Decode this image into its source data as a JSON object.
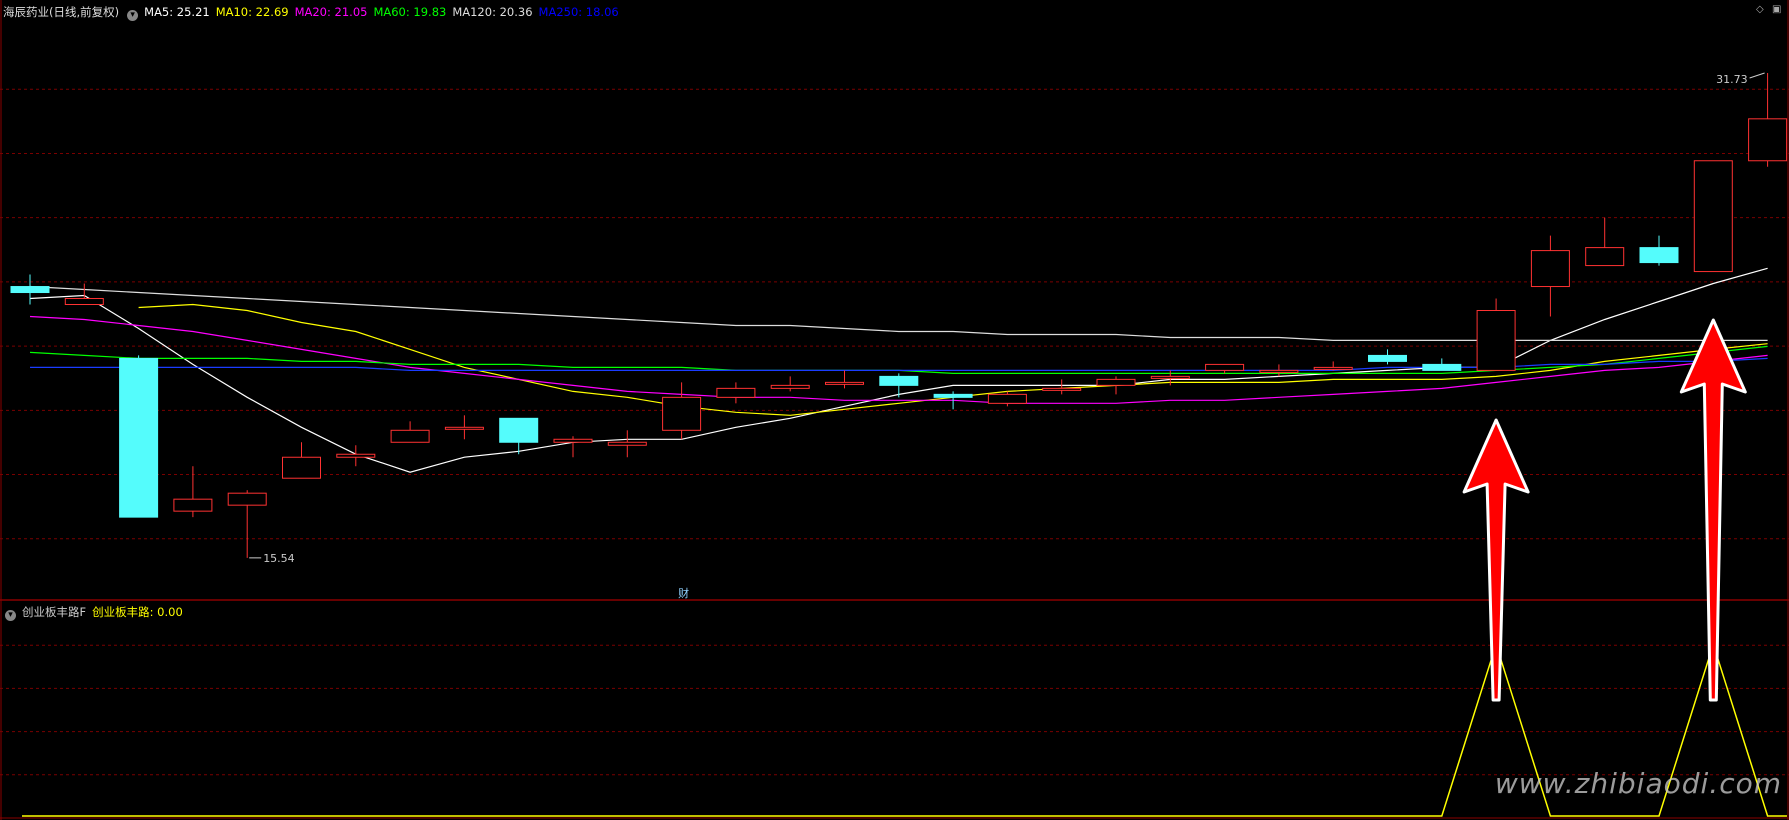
{
  "header": {
    "stock": "海辰药业(日线,前复权)",
    "ma": [
      {
        "label": "MA5: 25.21",
        "color": "#ffffff"
      },
      {
        "label": "MA10: 22.69",
        "color": "#ffff00"
      },
      {
        "label": "MA20: 21.05",
        "color": "#ff00ff"
      },
      {
        "label": "MA60: 19.83",
        "color": "#00ff00"
      },
      {
        "label": "MA120: 20.36",
        "color": "#dddddd"
      },
      {
        "label": "MA250: 18.06",
        "color": "#0000ff"
      }
    ]
  },
  "sub_header": {
    "indicator": "创业板丰路F",
    "value_label": "创业板丰路: 0.00",
    "value_color": "#ffff00"
  },
  "annotations": {
    "high_label": "31.73",
    "low_label": "15.54",
    "event_marker": "财",
    "watermark": "www.zhibiaodi.com"
  },
  "colors": {
    "up": "#ff3232",
    "down": "#54fcfc",
    "grid": "#7a0000",
    "indicator": "#ffff00",
    "arrow": "#ff0000"
  },
  "chart_data": {
    "type": "candlestick",
    "ylim": [
      14.2,
      33.5
    ],
    "candles": [
      {
        "o": 24.6,
        "h": 25.0,
        "l": 24.0,
        "c": 24.4
      },
      {
        "o": 24.0,
        "h": 24.7,
        "l": 24.0,
        "c": 24.2
      },
      {
        "o": 22.2,
        "h": 22.3,
        "l": 16.9,
        "c": 16.9
      },
      {
        "o": 17.1,
        "h": 18.6,
        "l": 16.9,
        "c": 17.5
      },
      {
        "o": 17.3,
        "h": 17.8,
        "l": 15.54,
        "c": 17.7
      },
      {
        "o": 18.2,
        "h": 19.4,
        "l": 18.2,
        "c": 18.9
      },
      {
        "o": 18.9,
        "h": 19.3,
        "l": 18.6,
        "c": 19.0
      },
      {
        "o": 19.4,
        "h": 20.1,
        "l": 19.4,
        "c": 19.8
      },
      {
        "o": 19.9,
        "h": 20.3,
        "l": 19.5,
        "c": 19.9
      },
      {
        "o": 20.2,
        "h": 20.2,
        "l": 19.0,
        "c": 19.4
      },
      {
        "o": 19.4,
        "h": 19.6,
        "l": 18.9,
        "c": 19.5
      },
      {
        "o": 19.3,
        "h": 19.8,
        "l": 18.9,
        "c": 19.4
      },
      {
        "o": 19.8,
        "h": 21.4,
        "l": 19.5,
        "c": 20.9
      },
      {
        "o": 20.9,
        "h": 21.4,
        "l": 20.7,
        "c": 21.2
      },
      {
        "o": 21.2,
        "h": 21.6,
        "l": 21.1,
        "c": 21.3
      },
      {
        "o": 21.4,
        "h": 21.8,
        "l": 21.2,
        "c": 21.4
      },
      {
        "o": 21.6,
        "h": 21.7,
        "l": 20.9,
        "c": 21.3
      },
      {
        "o": 21.0,
        "h": 21.1,
        "l": 20.5,
        "c": 20.9
      },
      {
        "o": 20.7,
        "h": 21.1,
        "l": 20.6,
        "c": 21.0
      },
      {
        "o": 21.2,
        "h": 21.5,
        "l": 21.0,
        "c": 21.2
      },
      {
        "o": 21.3,
        "h": 21.6,
        "l": 21.0,
        "c": 21.5
      },
      {
        "o": 21.6,
        "h": 21.8,
        "l": 21.3,
        "c": 21.6
      },
      {
        "o": 21.8,
        "h": 22.0,
        "l": 21.7,
        "c": 22.0
      },
      {
        "o": 21.8,
        "h": 22.0,
        "l": 21.6,
        "c": 21.8
      },
      {
        "o": 21.9,
        "h": 22.1,
        "l": 21.8,
        "c": 21.9
      },
      {
        "o": 22.3,
        "h": 22.5,
        "l": 22.0,
        "c": 22.1
      },
      {
        "o": 22.0,
        "h": 22.2,
        "l": 21.8,
        "c": 21.8
      },
      {
        "o": 21.8,
        "h": 24.2,
        "l": 21.8,
        "c": 23.8
      },
      {
        "o": 24.6,
        "h": 26.3,
        "l": 23.6,
        "c": 25.8
      },
      {
        "o": 25.3,
        "h": 26.9,
        "l": 25.3,
        "c": 25.9
      },
      {
        "o": 25.9,
        "h": 26.3,
        "l": 25.3,
        "c": 25.4
      },
      {
        "o": 25.1,
        "h": 28.8,
        "l": 25.1,
        "c": 28.8
      },
      {
        "o": 28.8,
        "h": 31.73,
        "l": 28.6,
        "c": 30.2
      }
    ],
    "ma_series": [
      {
        "name": "MA5",
        "color": "#ffffff",
        "values": [
          24.2,
          24.3,
          23.2,
          22.0,
          20.9,
          19.9,
          19.0,
          18.4,
          18.9,
          19.1,
          19.4,
          19.5,
          19.5,
          19.9,
          20.2,
          20.6,
          21.0,
          21.3,
          21.3,
          21.3,
          21.3,
          21.5,
          21.5,
          21.6,
          21.7,
          21.8,
          21.9,
          21.9,
          22.8,
          23.5,
          24.1,
          24.7,
          25.21
        ]
      },
      {
        "name": "MA10",
        "color": "#ffff00",
        "values": [
          23.9,
          24.0,
          23.8,
          23.4,
          23.1,
          22.5,
          21.9,
          21.5,
          21.1,
          20.9,
          20.6,
          20.4,
          20.3,
          20.5,
          20.7,
          20.9,
          21.1,
          21.2,
          21.3,
          21.4,
          21.4,
          21.4,
          21.5,
          21.5,
          21.5,
          21.6,
          21.8,
          22.1,
          22.3,
          22.5,
          22.69
        ]
      },
      {
        "name": "MA20",
        "color": "#ff00ff",
        "values": [
          23.6,
          23.5,
          23.3,
          23.1,
          22.8,
          22.5,
          22.2,
          21.9,
          21.7,
          21.5,
          21.3,
          21.1,
          21.0,
          20.9,
          20.9,
          20.8,
          20.8,
          20.8,
          20.7,
          20.7,
          20.7,
          20.8,
          20.8,
          20.9,
          21.0,
          21.1,
          21.2,
          21.4,
          21.6,
          21.8,
          21.9,
          22.1,
          22.3
        ]
      },
      {
        "name": "MA60",
        "color": "#00ff00",
        "values": [
          22.4,
          22.3,
          22.2,
          22.2,
          22.2,
          22.1,
          22.1,
          22.0,
          22.0,
          22.0,
          21.9,
          21.9,
          21.9,
          21.8,
          21.8,
          21.8,
          21.8,
          21.7,
          21.7,
          21.7,
          21.7,
          21.7,
          21.7,
          21.7,
          21.7,
          21.7,
          21.7,
          21.8,
          21.9,
          22.0,
          22.2,
          22.4,
          22.6
        ]
      },
      {
        "name": "MA120",
        "color": "#dddddd",
        "values": [
          24.6,
          24.5,
          24.4,
          24.3,
          24.2,
          24.1,
          24.0,
          23.9,
          23.8,
          23.7,
          23.6,
          23.5,
          23.4,
          23.3,
          23.3,
          23.2,
          23.1,
          23.1,
          23.0,
          23.0,
          23.0,
          22.9,
          22.9,
          22.9,
          22.8,
          22.8,
          22.8,
          22.8,
          22.8,
          22.8,
          22.8,
          22.8,
          22.8
        ]
      },
      {
        "name": "MA250",
        "color": "#1a3cff",
        "values": [
          21.9,
          21.9,
          21.9,
          21.9,
          21.9,
          21.9,
          21.9,
          21.8,
          21.8,
          21.8,
          21.8,
          21.8,
          21.8,
          21.8,
          21.8,
          21.8,
          21.8,
          21.8,
          21.8,
          21.8,
          21.8,
          21.8,
          21.8,
          21.8,
          21.8,
          21.9,
          21.9,
          21.9,
          22.0,
          22.0,
          22.1,
          22.1,
          22.2
        ]
      }
    ],
    "indicator": {
      "name": "创业板丰路",
      "ylim": [
        0,
        1.2
      ],
      "values": [
        0,
        0,
        0,
        0,
        0,
        0,
        0,
        0,
        0,
        0,
        0,
        0,
        0,
        0,
        0,
        0,
        0,
        0,
        0,
        0,
        0,
        0,
        0,
        0,
        0,
        0,
        0,
        1,
        0,
        0,
        0,
        1,
        0
      ]
    },
    "signals": [
      27,
      31
    ]
  }
}
